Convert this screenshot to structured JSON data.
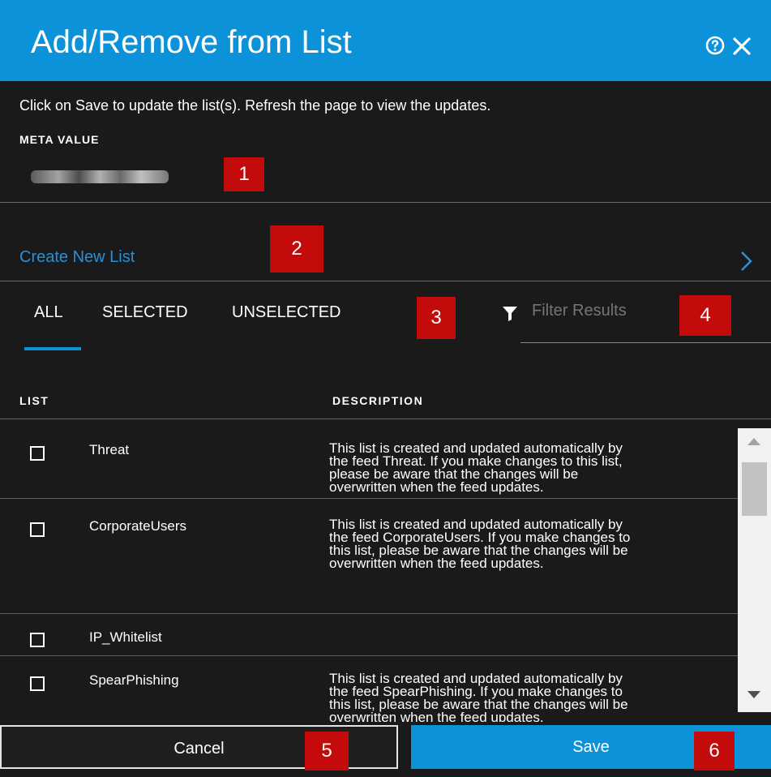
{
  "dialog": {
    "title": "Add/Remove from List",
    "help_icon": "help-circle-icon",
    "close_icon": "close-icon",
    "accent_color": "#0b92d8"
  },
  "instructions": "Click on Save to update the list(s). Refresh the page to view the updates.",
  "meta": {
    "label": "META VALUE"
  },
  "create_list": {
    "label": "Create New List",
    "icon": "chevron-right-icon"
  },
  "tabs": [
    {
      "label": "ALL",
      "active": true
    },
    {
      "label": "SELECTED",
      "active": false
    },
    {
      "label": "UNSELECTED",
      "active": false
    }
  ],
  "filter": {
    "placeholder": "Filter Results",
    "icon": "filter-icon"
  },
  "table": {
    "headers": [
      "LIST",
      "DESCRIPTION"
    ],
    "rows": [
      {
        "name": "Threat",
        "checked": false,
        "description": "This list is created and updated automatically by\nthe feed Threat. If you make changes to this list,\nplease be aware that the changes will be\noverwritten when the feed updates."
      },
      {
        "name": "CorporateUsers",
        "checked": false,
        "description": "This list is created and updated automatically by\nthe feed CorporateUsers. If you make changes to\nthis list, please be aware that the changes will be\noverwritten when the feed updates."
      },
      {
        "name": "IP_Whitelist",
        "checked": false,
        "description": ""
      },
      {
        "name": "SpearPhishing",
        "checked": false,
        "description": "This list is created and updated automatically by\nthe feed SpearPhishing. If you make changes to\nthis list, please be aware that the changes will be\noverwritten when the feed updates."
      }
    ]
  },
  "buttons": {
    "cancel": "Cancel",
    "save": "Save"
  },
  "callouts": [
    "1",
    "2",
    "3",
    "4",
    "5",
    "6"
  ],
  "callout_color": "#c40b0b"
}
